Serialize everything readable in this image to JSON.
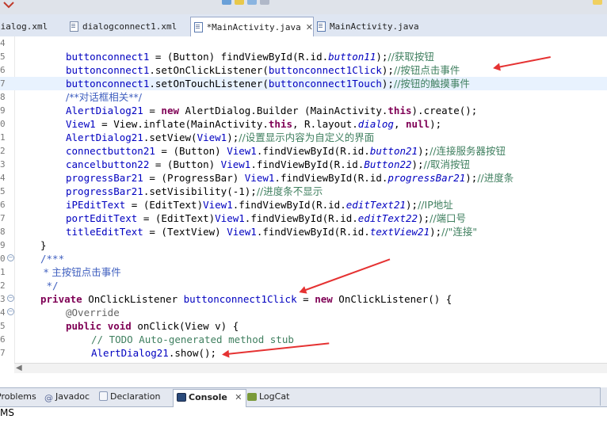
{
  "toolbar": {
    "icons": [
      "run-arrow-icon",
      "toolbar-icon",
      "lightbulb-icon"
    ]
  },
  "tabs": [
    {
      "label": "dialog.xml",
      "icon": "xml-file-icon",
      "active": false
    },
    {
      "label": "dialogconnect1.xml",
      "icon": "xml-file-icon",
      "active": false
    },
    {
      "label": "*MainActivity.java",
      "icon": "java-file-icon",
      "active": true,
      "close": "✕"
    },
    {
      "label": "MainActivity.java",
      "icon": "java-file-icon",
      "active": false
    }
  ],
  "editor": {
    "line_numbers": [
      "4",
      "5",
      "6",
      "7",
      "8",
      "9",
      "0",
      "1",
      "2",
      "3",
      "4",
      "5",
      "6",
      "7",
      "8",
      "9",
      "0",
      "1",
      "2",
      "3",
      "4",
      "5",
      "6",
      "7"
    ],
    "fold_markers": {
      "16": "−",
      "19": "−",
      "20": "−"
    },
    "highlighted_line_index": 3,
    "lines": [
      [],
      [
        {
          "t": "buttonconnect1",
          "c": "f"
        },
        {
          "t": " = (Button) findViewById(R.id.",
          "c": "n"
        },
        {
          "t": "button11",
          "c": "s"
        },
        {
          "t": ");",
          "c": "n"
        },
        {
          "t": "//获取按钮",
          "c": "m"
        }
      ],
      [
        {
          "t": "buttonconnect1",
          "c": "f"
        },
        {
          "t": ".setOnClickListener(",
          "c": "n"
        },
        {
          "t": "buttonconnect1Click",
          "c": "f"
        },
        {
          "t": ");",
          "c": "n"
        },
        {
          "t": "//按钮点击事件",
          "c": "m"
        }
      ],
      [
        {
          "t": "buttonconnect1",
          "c": "f"
        },
        {
          "t": ".setOnTouchListener(",
          "c": "n"
        },
        {
          "t": "buttonconnect1Touch",
          "c": "f"
        },
        {
          "t": ");",
          "c": "n"
        },
        {
          "t": "//按钮的触摸事件",
          "c": "m"
        }
      ],
      [
        {
          "t": "/**对话框相关**/",
          "c": "j"
        }
      ],
      [
        {
          "t": "AlertDialog21",
          "c": "f"
        },
        {
          "t": " = ",
          "c": "n"
        },
        {
          "t": "new",
          "c": "k"
        },
        {
          "t": " AlertDialog.Builder (MainActivity.",
          "c": "n"
        },
        {
          "t": "this",
          "c": "k"
        },
        {
          "t": ").create();",
          "c": "n"
        }
      ],
      [
        {
          "t": "View1",
          "c": "f"
        },
        {
          "t": " = View.inflate(MainActivity.",
          "c": "n"
        },
        {
          "t": "this",
          "c": "k"
        },
        {
          "t": ", R.layout.",
          "c": "n"
        },
        {
          "t": "dialog",
          "c": "s"
        },
        {
          "t": ", ",
          "c": "n"
        },
        {
          "t": "null",
          "c": "k"
        },
        {
          "t": ");",
          "c": "n"
        }
      ],
      [
        {
          "t": "AlertDialog21",
          "c": "f"
        },
        {
          "t": ".setView(",
          "c": "n"
        },
        {
          "t": "View1",
          "c": "f"
        },
        {
          "t": ");",
          "c": "n"
        },
        {
          "t": "//设置显示内容为自定义的界面",
          "c": "m"
        }
      ],
      [
        {
          "t": "connectbutton21",
          "c": "f"
        },
        {
          "t": " = (Button) ",
          "c": "n"
        },
        {
          "t": "View1",
          "c": "f"
        },
        {
          "t": ".findViewById(R.id.",
          "c": "n"
        },
        {
          "t": "button21",
          "c": "s"
        },
        {
          "t": ");",
          "c": "n"
        },
        {
          "t": "//连接服务器按钮",
          "c": "m"
        }
      ],
      [
        {
          "t": "cancelbutton22",
          "c": "f"
        },
        {
          "t": " = (Button) ",
          "c": "n"
        },
        {
          "t": "View1",
          "c": "f"
        },
        {
          "t": ".findViewById(R.id.",
          "c": "n"
        },
        {
          "t": "Button22",
          "c": "s"
        },
        {
          "t": ");",
          "c": "n"
        },
        {
          "t": "//取消按钮",
          "c": "m"
        }
      ],
      [
        {
          "t": "progressBar21",
          "c": "f"
        },
        {
          "t": " = (ProgressBar) ",
          "c": "n"
        },
        {
          "t": "View1",
          "c": "f"
        },
        {
          "t": ".findViewById(R.id.",
          "c": "n"
        },
        {
          "t": "progressBar21",
          "c": "s"
        },
        {
          "t": ");",
          "c": "n"
        },
        {
          "t": "//进度条",
          "c": "m"
        }
      ],
      [
        {
          "t": "progressBar21",
          "c": "f"
        },
        {
          "t": ".setVisibility(-1);",
          "c": "n"
        },
        {
          "t": "//进度条不显示",
          "c": "m"
        }
      ],
      [
        {
          "t": "iPEditText",
          "c": "f"
        },
        {
          "t": " = (EditText)",
          "c": "n"
        },
        {
          "t": "View1",
          "c": "f"
        },
        {
          "t": ".findViewById(R.id.",
          "c": "n"
        },
        {
          "t": "editText21",
          "c": "s"
        },
        {
          "t": ");",
          "c": "n"
        },
        {
          "t": "//IP地址",
          "c": "m"
        }
      ],
      [
        {
          "t": "portEditText",
          "c": "f"
        },
        {
          "t": " = (EditText)",
          "c": "n"
        },
        {
          "t": "View1",
          "c": "f"
        },
        {
          "t": ".findViewById(R.id.",
          "c": "n"
        },
        {
          "t": "editText22",
          "c": "s"
        },
        {
          "t": ");",
          "c": "n"
        },
        {
          "t": "//端口号",
          "c": "m"
        }
      ],
      [
        {
          "t": "titleEditText",
          "c": "f"
        },
        {
          "t": " = (TextView) ",
          "c": "n"
        },
        {
          "t": "View1",
          "c": "f"
        },
        {
          "t": ".findViewById(R.id.",
          "c": "n"
        },
        {
          "t": "textView21",
          "c": "s"
        },
        {
          "t": ");",
          "c": "n"
        },
        {
          "t": "//\"连接\"",
          "c": "m"
        }
      ],
      [
        {
          "t": "}",
          "c": "n"
        }
      ],
      [
        {
          "t": "/***",
          "c": "j"
        }
      ],
      [
        {
          "t": " * 主按钮点击事件",
          "c": "j"
        }
      ],
      [
        {
          "t": " */",
          "c": "j"
        }
      ],
      [
        {
          "t": "private",
          "c": "k"
        },
        {
          "t": " OnClickListener ",
          "c": "n"
        },
        {
          "t": "buttonconnect1Click",
          "c": "f"
        },
        {
          "t": " = ",
          "c": "n"
        },
        {
          "t": "new",
          "c": "k"
        },
        {
          "t": " OnClickListener() {",
          "c": "n"
        }
      ],
      [
        {
          "t": "@Override",
          "c": "a"
        }
      ],
      [
        {
          "t": "public",
          "c": "k"
        },
        {
          "t": " ",
          "c": "n"
        },
        {
          "t": "void",
          "c": "k"
        },
        {
          "t": " onClick(View v) {",
          "c": "n"
        }
      ],
      [
        {
          "t": "// TODO Auto-generated method stub",
          "c": "m"
        }
      ],
      [
        {
          "t": "AlertDialog21",
          "c": "f"
        },
        {
          "t": ".show();",
          "c": "n"
        }
      ]
    ]
  },
  "colors": {
    "n": "#000000",
    "f": "#0000c0",
    "s": "#0000c0",
    "k": "#7f0055",
    "m": "#3f7f5f",
    "j": "#3f5fbf",
    "a": "#646464",
    "arrow": "#e53232"
  },
  "bottom_panel": {
    "tabs": [
      {
        "label": "Problems",
        "icon": "problems-icon"
      },
      {
        "label": "Javadoc",
        "icon": "javadoc-icon"
      },
      {
        "label": "Declaration",
        "icon": "declaration-icon"
      },
      {
        "label": "Console",
        "icon": "console-icon",
        "active": true,
        "close": "✕"
      },
      {
        "label": "LogCat",
        "icon": "logcat-icon"
      }
    ]
  },
  "status_text": "MS"
}
